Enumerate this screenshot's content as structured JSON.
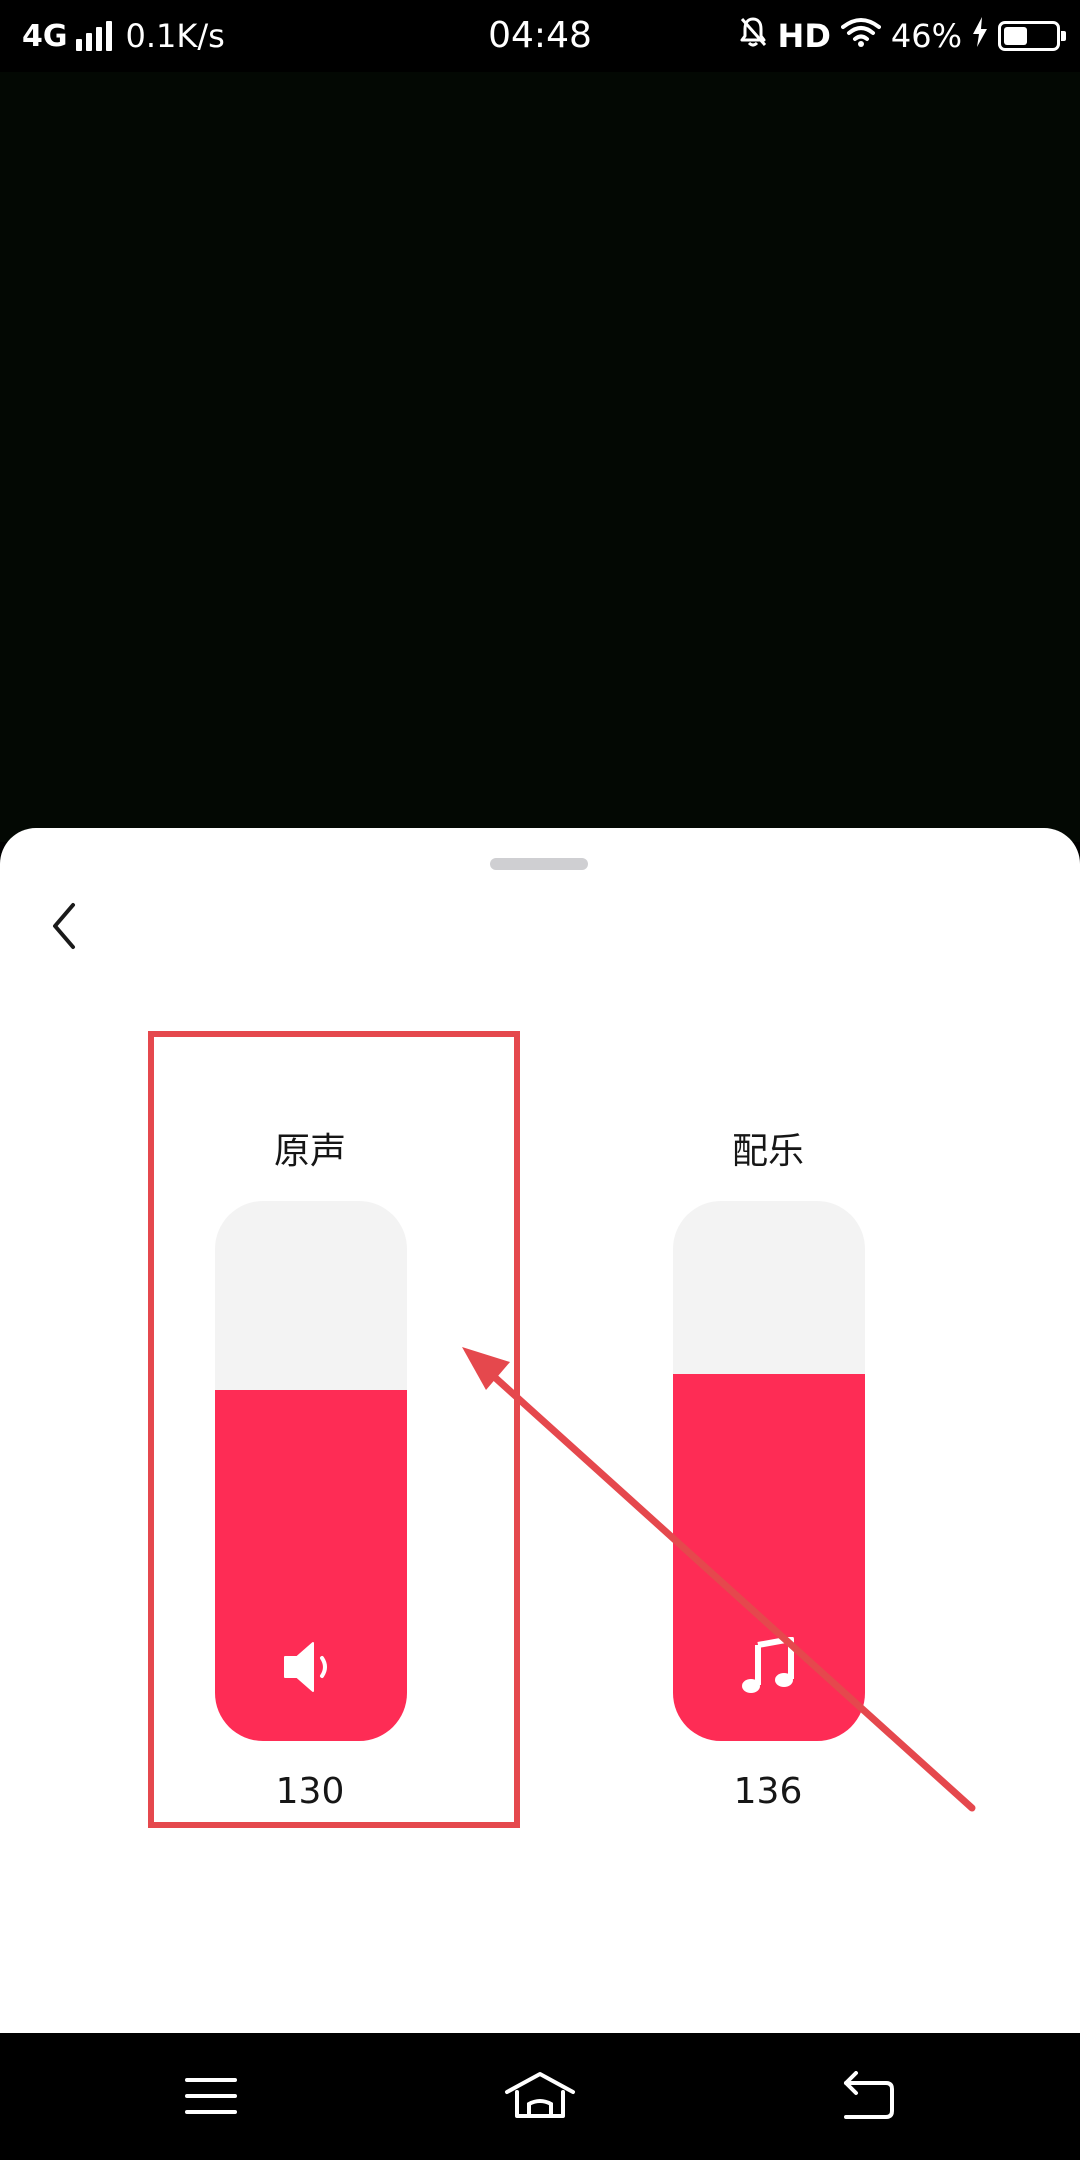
{
  "status_bar": {
    "network": "4G",
    "speed": "0.1K/s",
    "time": "04:48",
    "hd": "HD",
    "battery": "46%",
    "battery_level": 0.46,
    "icons": [
      "signal-icon",
      "mute-bell-icon",
      "wifi-icon",
      "charging-icon",
      "battery-icon"
    ]
  },
  "sheet": {
    "back_icon": "chevron-left-icon",
    "channels": [
      {
        "label": "原声",
        "value": "130",
        "fill_fraction": 0.65,
        "icon": "speaker-icon"
      },
      {
        "label": "配乐",
        "value": "136",
        "fill_fraction": 0.68,
        "icon": "music-note-icon"
      }
    ]
  },
  "colors": {
    "accent": "#fe2c55",
    "track": "#f3f3f3",
    "annotation": "#e5484d"
  },
  "nav_bar": {
    "icons": [
      "menu-icon",
      "home-icon",
      "back-arrow-icon"
    ]
  }
}
